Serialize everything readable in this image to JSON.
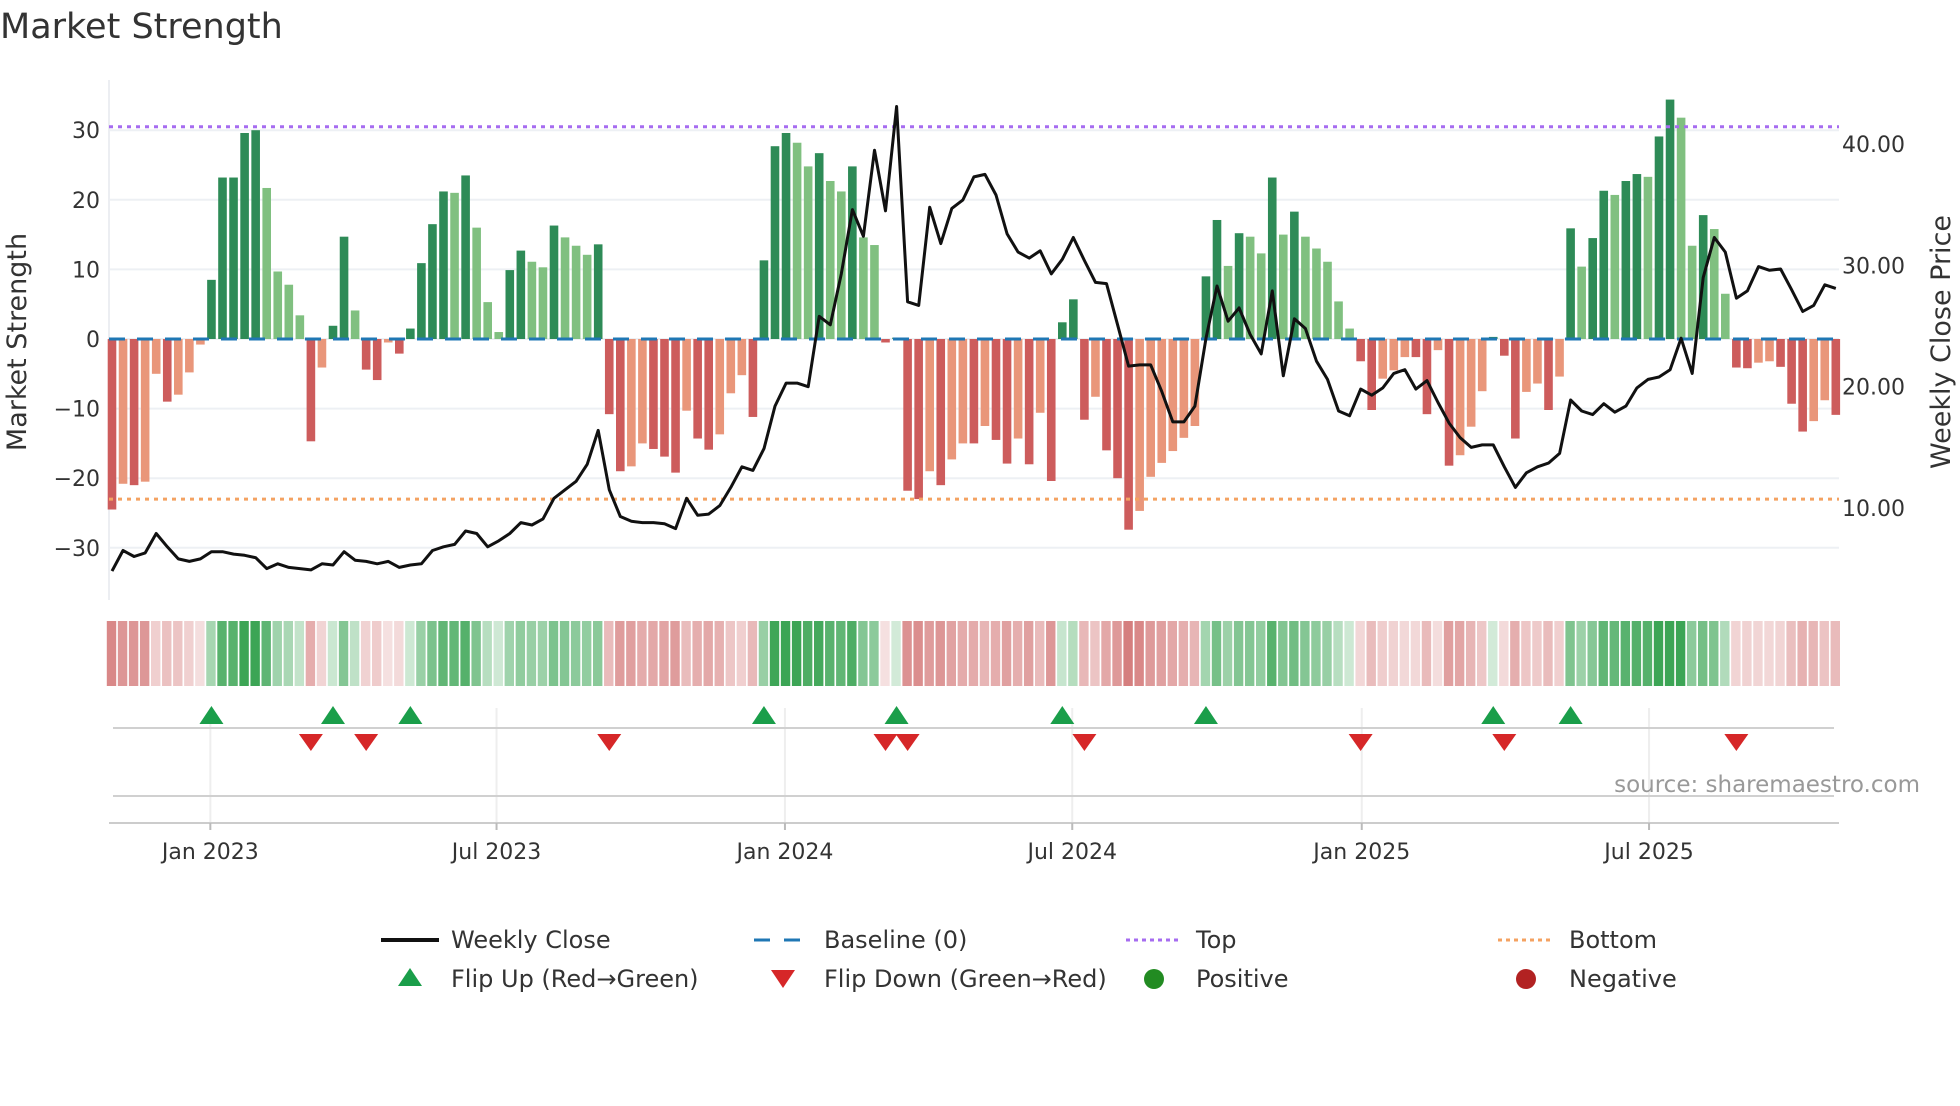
{
  "chart_data": {
    "type": "bar",
    "title": "Market Strength",
    "ylabel": "Market Strength",
    "ylabel_right": "Weekly Close Price",
    "ylim": [
      -37,
      36
    ],
    "ylim_right": [
      3,
      45
    ],
    "yticks": [
      -30,
      -20,
      -10,
      0,
      10,
      20,
      30
    ],
    "ytick_labels": [
      "−30",
      "−20",
      "−10",
      "0",
      "10",
      "20",
      "30"
    ],
    "yticks_right": [
      10,
      20,
      30,
      40
    ],
    "ytick_labels_right": [
      "10.00",
      "20.00",
      "30.00",
      "40.00"
    ],
    "xticks": [
      {
        "label": "Jan 2023",
        "week": 8.9
      },
      {
        "label": "Jul 2023",
        "week": 34.8
      },
      {
        "label": "Jan 2024",
        "week": 60.9
      },
      {
        "label": "Jul 2024",
        "week": 86.9
      },
      {
        "label": "Jan 2025",
        "week": 113.1
      },
      {
        "label": "Jul 2025",
        "week": 139.1
      }
    ],
    "top_level": 30.5,
    "bottom_level": -23,
    "baseline": 0,
    "strength": [
      -24.5,
      -20.8,
      -21,
      -20.5,
      -5,
      -9,
      -8,
      -4.8,
      -0.8,
      8.5,
      23.2,
      23.2,
      29.6,
      30,
      21.7,
      9.7,
      7.8,
      3.4,
      -14.7,
      -4.1,
      1.9,
      14.7,
      4.1,
      -4.4,
      -5.9,
      -0.5,
      -2.1,
      1.5,
      10.9,
      16.5,
      21.2,
      21,
      23.5,
      16,
      5.3,
      1,
      9.9,
      12.7,
      11.1,
      10.3,
      16.3,
      14.6,
      13.4,
      12.1,
      13.6,
      -10.8,
      -19,
      -18.3,
      -15,
      -15.8,
      -16.9,
      -19.2,
      -10.3,
      -14.3,
      -15.9,
      -13.7,
      -7.8,
      -5.2,
      -11.2,
      11.3,
      27.7,
      29.6,
      28.2,
      24.8,
      26.7,
      22.7,
      21.2,
      24.8,
      14.6,
      13.5,
      -0.5,
      0.2,
      -21.8,
      -23,
      -19,
      -21,
      -17.3,
      -15,
      -15,
      -12.5,
      -14.5,
      -17.9,
      -14.3,
      -18,
      -10.6,
      -20.4,
      2.4,
      5.7,
      -11.6,
      -8.3,
      -16,
      -20,
      -27.4,
      -24.7,
      -19.8,
      -17.8,
      -16.1,
      -14.2,
      -12.5,
      9,
      17.1,
      10.5,
      15.2,
      14.7,
      12.3,
      23.2,
      15,
      18.3,
      14.7,
      13,
      11.1,
      5.4,
      1.5,
      -3.2,
      -10.2,
      -5.7,
      -4.5,
      -2.6,
      -2.6,
      -10.8,
      -1.6,
      -18.2,
      -16.7,
      -12.6,
      -7.5,
      0.3,
      -2.4,
      -14.3,
      -7.6,
      -6.4,
      -10.2,
      -5.4,
      15.9,
      10.4,
      14.5,
      21.3,
      20.7,
      22.7,
      23.7,
      23.3,
      29.1,
      34.4,
      31.8,
      13.4,
      17.8,
      15.8,
      6.5,
      -4.1,
      -4.2,
      -3.4,
      -3.2,
      -4,
      -9.3,
      -13.3,
      -11.8,
      -8.8,
      -10.9
    ],
    "weekly_close": [
      4.8,
      6.5,
      6.0,
      6.3,
      7.9,
      6.8,
      5.8,
      5.6,
      5.8,
      6.4,
      6.4,
      6.2,
      6.1,
      5.9,
      5.0,
      5.4,
      5.1,
      5.0,
      4.9,
      5.4,
      5.3,
      6.4,
      5.7,
      5.6,
      5.4,
      5.6,
      5.1,
      5.3,
      5.4,
      6.5,
      6.8,
      7.0,
      8.1,
      7.9,
      6.8,
      7.3,
      7.9,
      8.8,
      8.6,
      9.1,
      10.8,
      11.5,
      12.2,
      13.6,
      16.4,
      11.5,
      9.3,
      8.9,
      8.8,
      8.8,
      8.7,
      8.3,
      10.8,
      9.4,
      9.5,
      10.2,
      11.7,
      13.4,
      13.1,
      14.9,
      18.4,
      20.3,
      20.3,
      20.0,
      25.8,
      25.1,
      29.3,
      34.6,
      32.4,
      39.5,
      34.5,
      43.1,
      27.0,
      26.7,
      34.8,
      31.8,
      34.7,
      35.4,
      37.3,
      37.5,
      35.8,
      32.6,
      31.1,
      30.6,
      31.2,
      29.3,
      30.5,
      32.3,
      30.4,
      28.6,
      28.5,
      25.1,
      21.7,
      21.8,
      21.8,
      19.6,
      17.1,
      17.1,
      18.4,
      24.0,
      28.3,
      25.4,
      26.5,
      24.3,
      22.7,
      27.9,
      20.9,
      25.6,
      24.8,
      22.1,
      20.6,
      18.0,
      17.6,
      19.8,
      19.3,
      19.9,
      21.1,
      21.4,
      19.8,
      20.5,
      18.7,
      17.0,
      15.8,
      15.0,
      15.2,
      15.2,
      13.4,
      11.7,
      12.9,
      13.4,
      13.7,
      14.5,
      18.9,
      18.0,
      17.7,
      18.6,
      17.9,
      18.4,
      19.9,
      20.6,
      20.8,
      21.4,
      24.0,
      21.1,
      29.0,
      32.3,
      31.1,
      27.3,
      27.9,
      29.9,
      29.6,
      29.7,
      28.0,
      26.2,
      26.7,
      28.4,
      28.1
    ],
    "flip_up_weeks": [
      9,
      20,
      27,
      59,
      71,
      86,
      99,
      125,
      132
    ],
    "flip_down_weeks": [
      18,
      23,
      45,
      70,
      72,
      88,
      113,
      126,
      147
    ],
    "legend": [
      {
        "label": "Weekly Close",
        "type": "line"
      },
      {
        "label": "Baseline (0)",
        "type": "dashed"
      },
      {
        "label": "Top",
        "type": "dotted-top"
      },
      {
        "label": "Bottom",
        "type": "dotted-bottom"
      },
      {
        "label": "Flip Up (Red→Green)",
        "type": "tri-up"
      },
      {
        "label": "Flip Down (Green→Red)",
        "type": "tri-down"
      },
      {
        "label": "Positive",
        "type": "dot-pos"
      },
      {
        "label": "Negative",
        "type": "dot-neg"
      }
    ],
    "legend_placement": "bottom",
    "source": "source: sharemaestro.com"
  },
  "colors": {
    "green_dark": "#2e8b57",
    "green_light": "#80c080",
    "red_dark": "#cd5c5c",
    "red_light": "#e9967a",
    "baseline": "#1f77b4",
    "top": "#a66cf0",
    "bottom": "#f4a261",
    "flip_up": "#1a9e4a",
    "flip_down": "#d62728",
    "positive": "#228b22",
    "negative": "#b22222",
    "close": "#111111"
  }
}
